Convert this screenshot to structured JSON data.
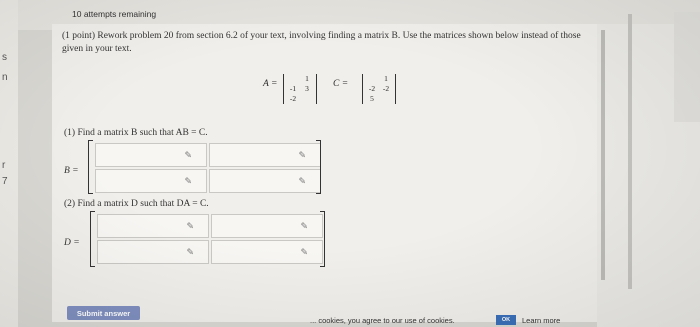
{
  "header": {
    "attempts": "10 attempts remaining"
  },
  "left_strip": {
    "chars": [
      "s",
      "n",
      "r",
      "7"
    ]
  },
  "problem": {
    "text": "(1 point) Rework problem 20 from section 6.2 of your text, involving finding a matrix B. Use the matrices shown below instead of those given in your text.",
    "matrix_a": {
      "label": "A =",
      "cells": [
        "1",
        "-1",
        "3",
        "-2"
      ]
    },
    "matrix_c": {
      "label": "C =",
      "cells": [
        "1",
        "-2",
        "-2",
        "5"
      ]
    }
  },
  "part1": {
    "question": "(1) Find a matrix B such that AB = C.",
    "answer_label": "B ="
  },
  "part2": {
    "question": "(2) Find a matrix D such that DA = C.",
    "answer_label": "D ="
  },
  "buttons": {
    "submit": "Submit answer"
  },
  "cookie": {
    "text": "... cookies, you agree to our use of cookies.",
    "ok": "OK",
    "learn_more": "Learn more"
  }
}
